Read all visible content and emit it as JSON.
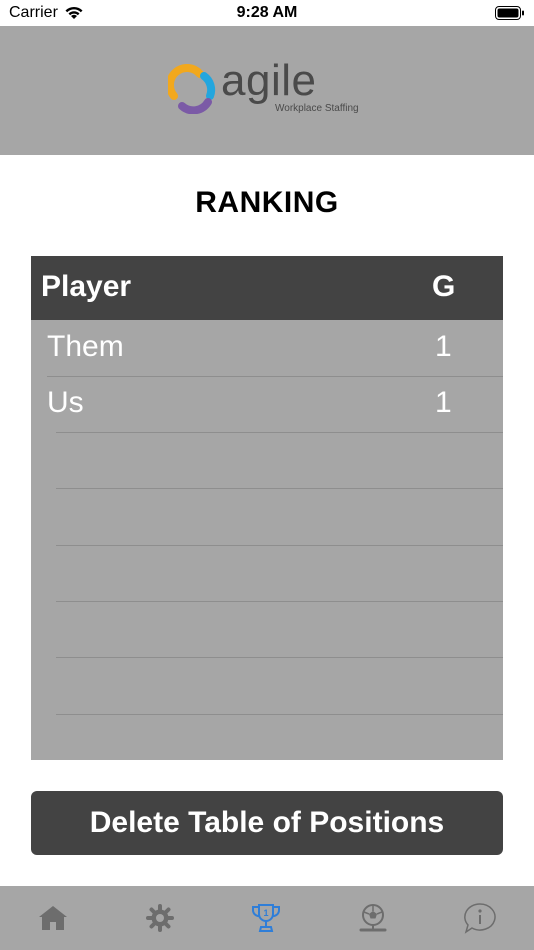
{
  "status_bar": {
    "carrier": "Carrier",
    "time": "9:28 AM"
  },
  "header": {
    "logo_word": "agile",
    "logo_subtitle": "Workplace Staffing"
  },
  "page_title": "RANKING",
  "table": {
    "columns": [
      "Player",
      "G"
    ],
    "rows": [
      {
        "player": "Them",
        "g": "1"
      },
      {
        "player": "Us",
        "g": "1"
      }
    ]
  },
  "delete_button_label": "Delete Table of Positions",
  "tab_bar": {
    "tabs": [
      {
        "icon": "home-icon",
        "active": false
      },
      {
        "icon": "gear-icon",
        "active": false
      },
      {
        "icon": "trophy-icon",
        "active": true
      },
      {
        "icon": "soccer-ball-icon",
        "active": false
      },
      {
        "icon": "info-bubble-icon",
        "active": false
      }
    ]
  },
  "colors": {
    "header_bg": "#a6a6a6",
    "dark": "#434343",
    "active_tab": "#2f7ed8",
    "inactive_tab": "#6d6d6d"
  }
}
